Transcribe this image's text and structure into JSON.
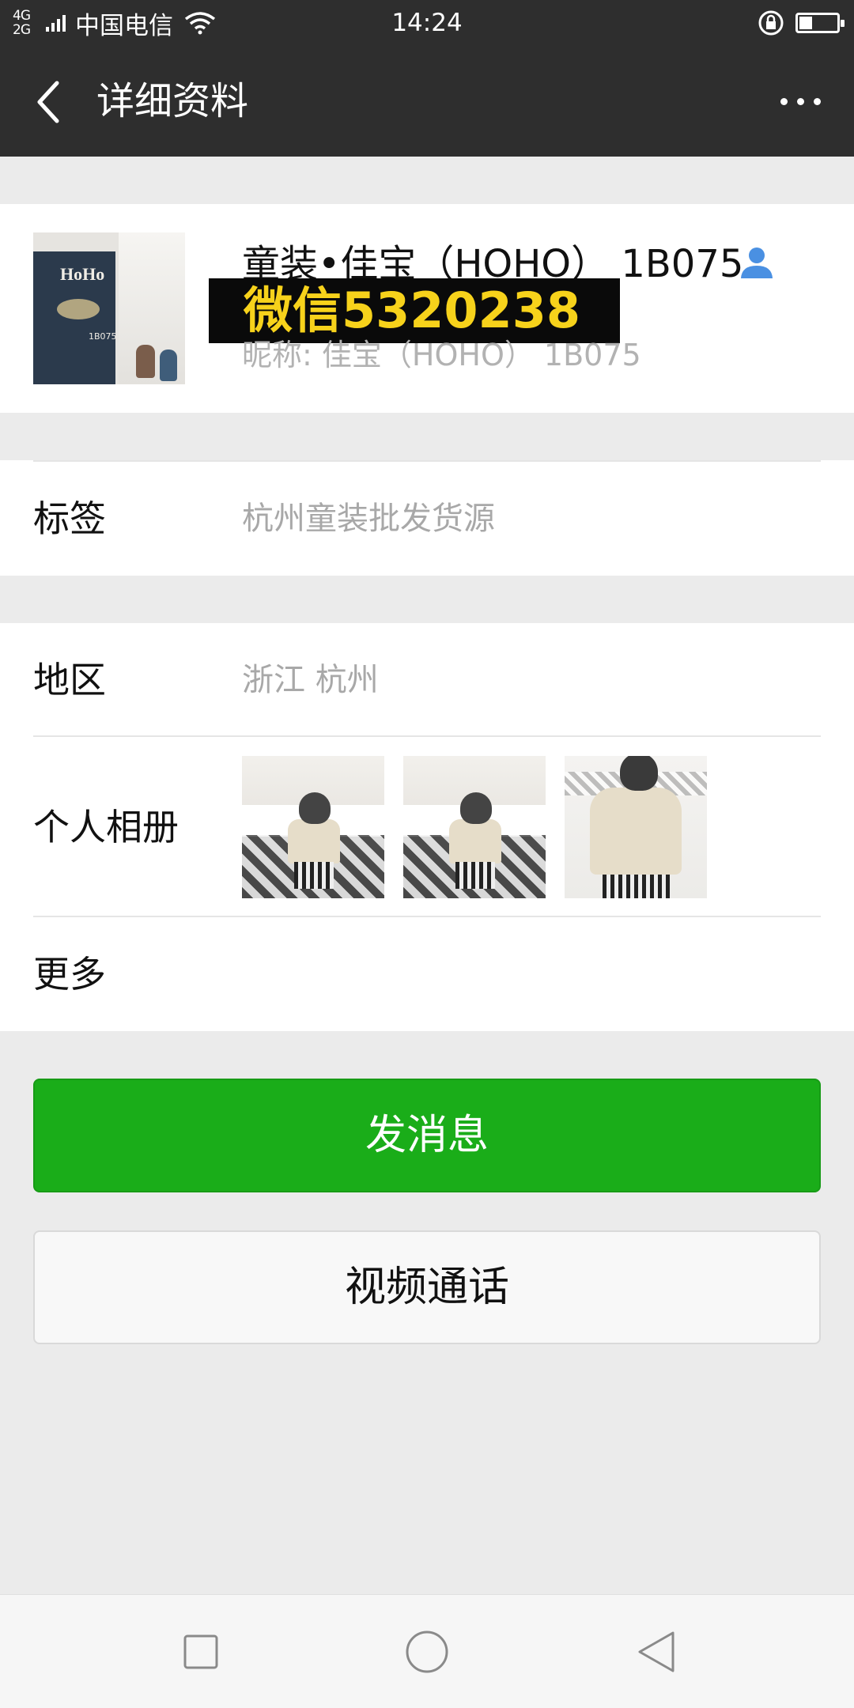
{
  "status_bar": {
    "network": "4G\n2G",
    "carrier": "中国电信",
    "time": "14:24",
    "battery_level": 0.35
  },
  "header": {
    "title": "详细资料",
    "back_icon": "chevron-left-icon",
    "more_icon": "ellipsis-icon"
  },
  "profile": {
    "name": "童装•佳宝（HOHO） 1B075",
    "watermark": "微信5320238",
    "nickname": "昵称: 佳宝（HOHO） 1B075",
    "avatar_text": "HoHo",
    "avatar_code": "1B075",
    "badge_icon": "contact-person-icon",
    "badge_color": "#4a90e2"
  },
  "tags": {
    "label": "标签",
    "value": "杭州童装批发货源"
  },
  "region": {
    "label": "地区",
    "value": "浙江  杭州"
  },
  "album": {
    "label": "个人相册",
    "photos": [
      "album-photo-1",
      "album-photo-2",
      "album-photo-3"
    ]
  },
  "more": {
    "label": "更多"
  },
  "actions": {
    "message_label": "发消息",
    "video_label": "视频通话",
    "primary_color": "#1aad19"
  },
  "nav": {
    "icons": [
      "recent-apps-icon",
      "home-icon",
      "back-icon"
    ]
  }
}
